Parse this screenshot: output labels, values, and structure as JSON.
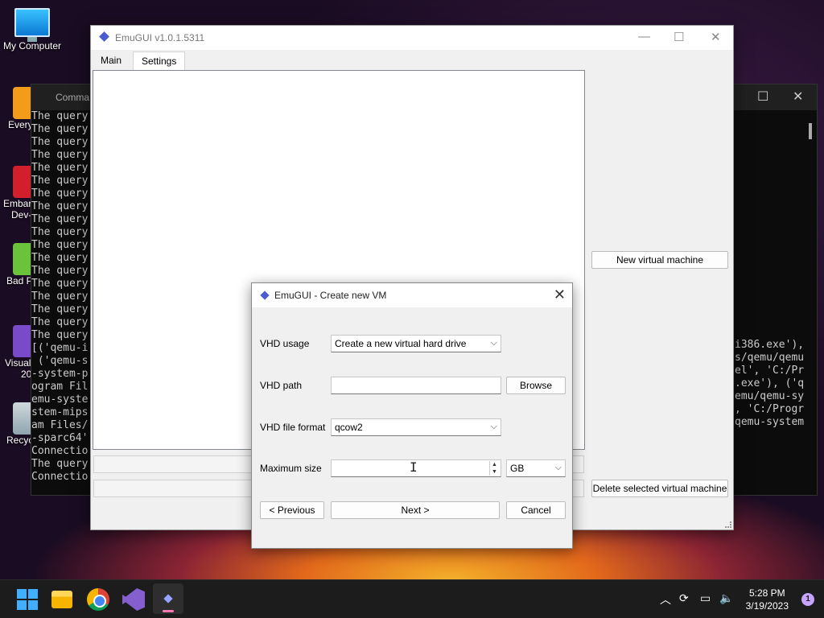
{
  "desktop": {
    "icons": [
      {
        "label": "My Computer"
      },
      {
        "label": "Every"
      },
      {
        "label": "Embar"
      },
      {
        "label": "Dev-"
      },
      {
        "label": "Bad P"
      },
      {
        "label": "Visual"
      },
      {
        "label": "20"
      },
      {
        "label": "Recyc"
      }
    ]
  },
  "cmd": {
    "title": "Comma",
    "lines_left": [
      "The query",
      "The query",
      "The query",
      "The query",
      "The query",
      "The query",
      "The query",
      "The query",
      "The query",
      "The query",
      "The query",
      "The query",
      "The query",
      "The query",
      "The query",
      "The query",
      "The query",
      "The query",
      "[('qemu-i",
      " ('qemu-s",
      "-system-p",
      "ogram Fil",
      "emu-syste",
      "stem-mips",
      "am Files/",
      "-sparc64'",
      "Connectio",
      "The query",
      "Connectio"
    ],
    "lines_right": [
      "i386.exe'),",
      "s/qemu/qemu",
      "el', 'C:/Pr",
      ".exe'), ('q",
      "emu/qemu-sy",
      ", 'C:/Progr",
      "qemu-system"
    ]
  },
  "main_window": {
    "title": "EmuGUI v1.0.1.5311",
    "tabs": [
      {
        "label": "Main"
      },
      {
        "label": "Settings"
      }
    ],
    "new_vm_button": "New virtual machine",
    "delete_vm_button": "Delete selected virtual machine"
  },
  "dialog": {
    "title": "EmuGUI - Create new VM",
    "vhd_usage_label": "VHD usage",
    "vhd_usage_value": "Create a new virtual hard drive",
    "vhd_path_label": "VHD path",
    "vhd_path_value": "",
    "browse_button": "Browse",
    "vhd_format_label": "VHD file format",
    "vhd_format_value": "qcow2",
    "max_size_label": "Maximum size",
    "max_size_value": "",
    "unit_value": "GB",
    "previous_button": "< Previous",
    "next_button": "Next >",
    "cancel_button": "Cancel"
  },
  "taskbar": {
    "time": "5:28 PM",
    "date": "3/19/2023",
    "notification_count": "1"
  }
}
